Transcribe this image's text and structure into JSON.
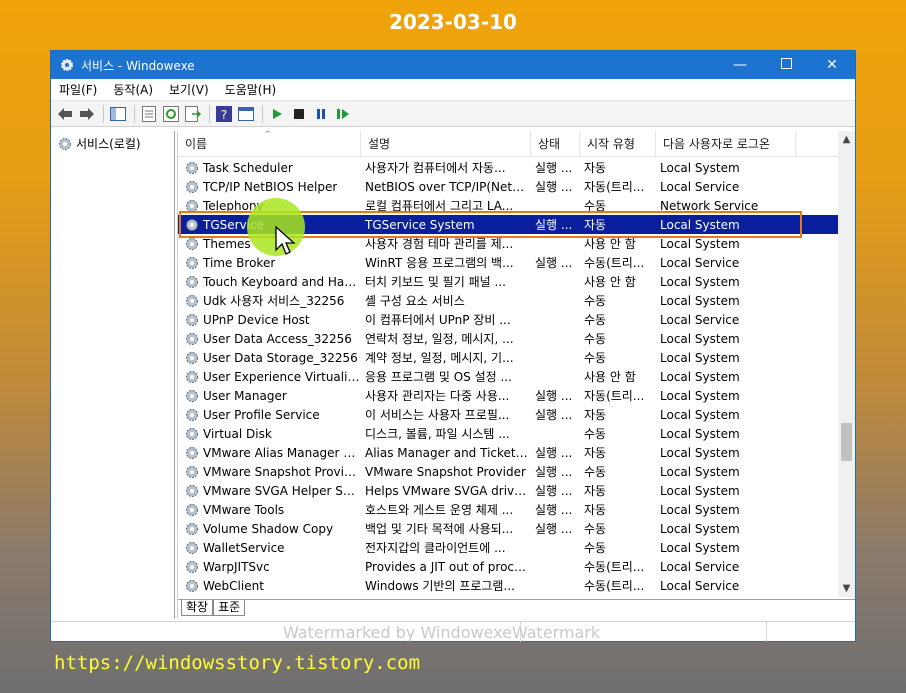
{
  "overlay": {
    "date": "2023-03-10",
    "url": "https://windowsstory.tistory.com",
    "watermark": "Watermarked by WindowexeWatermark"
  },
  "window": {
    "title": "서비스   - Windowexe",
    "controls": [
      "minimize-icon",
      "maximize-icon",
      "close-icon"
    ]
  },
  "menu": {
    "items": [
      "파일(F)",
      "동작(A)",
      "보기(V)",
      "도움말(H)"
    ]
  },
  "toolbar": {
    "icons": [
      "back-icon",
      "forward-icon",
      "show-tree-icon",
      "export-list-icon",
      "refresh-icon",
      "export-icon",
      "help-icon",
      "properties-icon",
      "start-service-icon",
      "stop-service-icon",
      "pause-service-icon",
      "restart-service-icon"
    ]
  },
  "tree": {
    "root_label": "서비스(로컬)"
  },
  "list": {
    "headers": [
      "이름",
      "설명",
      "상태",
      "시작 유형",
      "다음 사용자로 로그온"
    ],
    "rows": [
      {
        "name": "Task Scheduler",
        "desc": "사용자가 컴퓨터에서 자동...",
        "status": "실행 ...",
        "startup": "자동",
        "logon": "Local System"
      },
      {
        "name": "TCP/IP NetBIOS Helper",
        "desc": "NetBIOS over TCP/IP(NetBT...",
        "status": "실행 ...",
        "startup": "자동(트리...",
        "logon": "Local Service"
      },
      {
        "name": "Telephony",
        "desc": "로컬 컴퓨터에서 그리고 LA...",
        "status": "",
        "startup": "수동",
        "logon": "Network Service"
      },
      {
        "name": "TGService",
        "desc": "TGService System",
        "status": "실행 ...",
        "startup": "자동",
        "logon": "Local System",
        "selected": true
      },
      {
        "name": "Themes",
        "desc": "사용자 경험 테마 관리를 제...",
        "status": "",
        "startup": "사용 안 함",
        "logon": "Local System"
      },
      {
        "name": "Time Broker",
        "desc": "WinRT 응용 프로그램의 백...",
        "status": "실행 ...",
        "startup": "수동(트리...",
        "logon": "Local Service"
      },
      {
        "name": "Touch Keyboard and Hand...",
        "desc": "터치 키보드 및 필기 패널 ...",
        "status": "",
        "startup": "사용 안 함",
        "logon": "Local System"
      },
      {
        "name": "Udk 사용자 서비스_32256",
        "desc": "셸 구성 요소 서비스",
        "status": "",
        "startup": "수동",
        "logon": "Local System"
      },
      {
        "name": "UPnP Device Host",
        "desc": "이 컴퓨터에서 UPnP 장비 ...",
        "status": "",
        "startup": "수동",
        "logon": "Local Service"
      },
      {
        "name": "User Data Access_32256",
        "desc": "연락처 정보, 일정, 메시지, ...",
        "status": "",
        "startup": "수동",
        "logon": "Local System"
      },
      {
        "name": "User Data Storage_32256",
        "desc": "계약 정보, 일정, 메시지, 기...",
        "status": "",
        "startup": "수동",
        "logon": "Local System"
      },
      {
        "name": "User Experience Virtualizati...",
        "desc": "응용 프로그램 및 OS 설정 ...",
        "status": "",
        "startup": "사용 안 함",
        "logon": "Local System"
      },
      {
        "name": "User Manager",
        "desc": "사용자 관리자는 다중 사용...",
        "status": "실행 ...",
        "startup": "자동(트리...",
        "logon": "Local System"
      },
      {
        "name": "User Profile Service",
        "desc": "이 서비스는 사용자 프로필...",
        "status": "실행 ...",
        "startup": "자동",
        "logon": "Local System"
      },
      {
        "name": "Virtual Disk",
        "desc": "디스크, 볼륨, 파일 시스템 ...",
        "status": "",
        "startup": "수동",
        "logon": "Local System"
      },
      {
        "name": "VMware Alias Manager an...",
        "desc": "Alias Manager and Ticket S...",
        "status": "실행 ...",
        "startup": "자동",
        "logon": "Local System"
      },
      {
        "name": "VMware Snapshot Provider",
        "desc": "VMware Snapshot Provider",
        "status": "실행 ...",
        "startup": "수동",
        "logon": "Local System"
      },
      {
        "name": "VMware SVGA Helper Serv...",
        "desc": "Helps VMware SVGA driver...",
        "status": "실행 ...",
        "startup": "자동",
        "logon": "Local System"
      },
      {
        "name": "VMware Tools",
        "desc": "호스트와 게스트 운영 체제 ...",
        "status": "실행 ...",
        "startup": "자동",
        "logon": "Local System"
      },
      {
        "name": "Volume Shadow Copy",
        "desc": "백업 및 기타 목적에 사용되...",
        "status": "실행 ...",
        "startup": "수동",
        "logon": "Local System"
      },
      {
        "name": "WalletService",
        "desc": "전자지갑의 클라이언트에 ...",
        "status": "",
        "startup": "수동",
        "logon": "Local System"
      },
      {
        "name": "WarpJITSvc",
        "desc": "Provides a JIT out of proces...",
        "status": "",
        "startup": "수동(트리...",
        "logon": "Local Service"
      },
      {
        "name": "WebClient",
        "desc": "Windows 기반의 프로그램...",
        "status": "",
        "startup": "수동(트리...",
        "logon": "Local Service"
      }
    ]
  },
  "tabs": [
    "확장",
    "표준"
  ],
  "colors": {
    "titlebar": "#1c73d0",
    "selection": "#0a1f9e",
    "highlight_outline": "#e8791d",
    "url_text": "#ffff33"
  }
}
